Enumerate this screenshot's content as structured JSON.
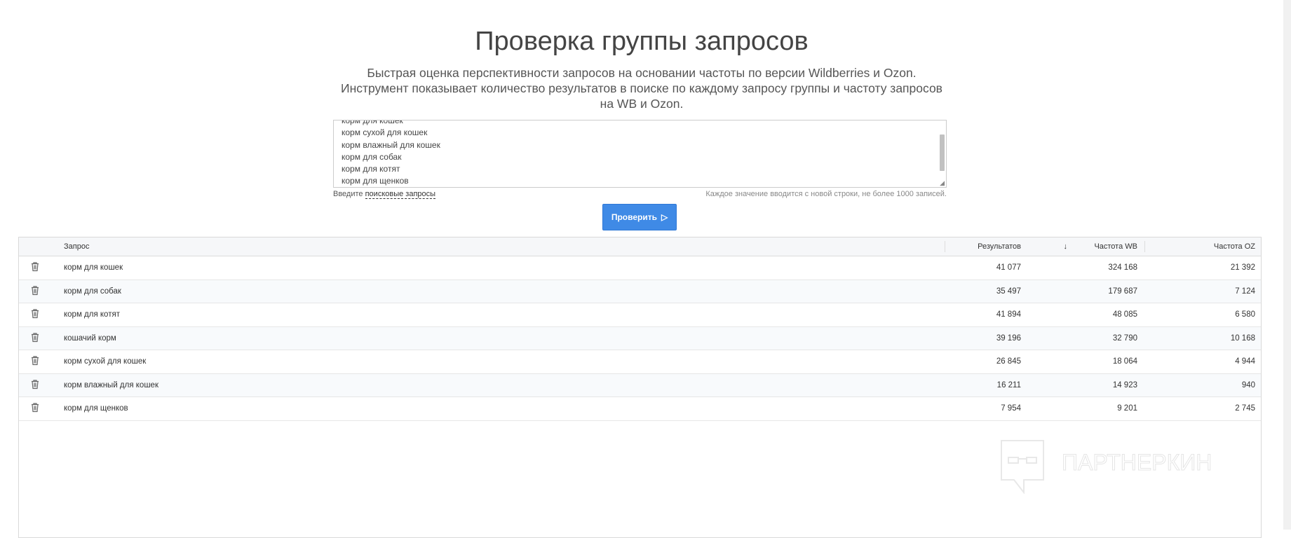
{
  "title": "Проверка группы запросов",
  "subtitle": [
    "Быстрая оценка перспективности запросов на основании частоты по версии Wildberries и Ozon.",
    "Инструмент показывает количество результатов в поиске по каждому запросу группы и частоту запросов",
    "на WB и Ozon."
  ],
  "textarea_lines": [
    "корм для кошек",
    "корм сухой для кошек",
    "корм влажный для кошек",
    "корм для собак",
    "корм для котят",
    "корм для щенков"
  ],
  "help_left": "Введите",
  "help_link": "поисковые запросы",
  "help_right": "Каждое значение вводится с новой строки, не более 1000 записей.",
  "button_label": "Проверить",
  "button_color": "#3f8ae6",
  "table": {
    "headers": {
      "query": "Запрос",
      "results": "Результатов",
      "wb": "Частота WB",
      "oz": "Частота OZ"
    },
    "sort_indicator": "↓",
    "rows": [
      {
        "query": "корм для кошек",
        "results": "41 077",
        "wb": "324 168",
        "oz": "21 392"
      },
      {
        "query": "корм для собак",
        "results": "35 497",
        "wb": "179 687",
        "oz": "7 124"
      },
      {
        "query": "корм для котят",
        "results": "41 894",
        "wb": "48 085",
        "oz": "6 580"
      },
      {
        "query": "кошачий корм",
        "results": "39 196",
        "wb": "32 790",
        "oz": "10 168"
      },
      {
        "query": "корм сухой для кошек",
        "results": "26 845",
        "wb": "18 064",
        "oz": "4 944"
      },
      {
        "query": "корм влажный для кошек",
        "results": "16 211",
        "wb": "14 923",
        "oz": "940"
      },
      {
        "query": "корм для щенков",
        "results": "7 954",
        "wb": "9 201",
        "oz": "2 745"
      }
    ]
  },
  "watermark": "ПАРТНЕРКИН"
}
